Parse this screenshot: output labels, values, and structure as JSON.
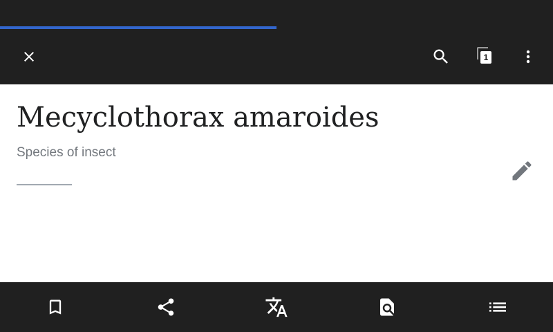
{
  "browser": {
    "load_progress": 0.5,
    "progress_color": "#3366cc",
    "bar_color": "#202020"
  },
  "toolbar": {
    "close_icon": "close-icon",
    "search_icon": "search-icon",
    "tabs_icon": "tabs-icon",
    "tab_count": "1",
    "overflow_icon": "overflow-menu-icon"
  },
  "article": {
    "title": "Mecyclothorax amaroides",
    "description": "Species of insect",
    "edit_icon": "pencil-icon"
  },
  "bottom_bar": {
    "items": [
      {
        "icon": "bookmark-icon"
      },
      {
        "icon": "share-icon"
      },
      {
        "icon": "translate-icon"
      },
      {
        "icon": "find-in-page-icon"
      },
      {
        "icon": "table-of-contents-icon"
      }
    ]
  }
}
